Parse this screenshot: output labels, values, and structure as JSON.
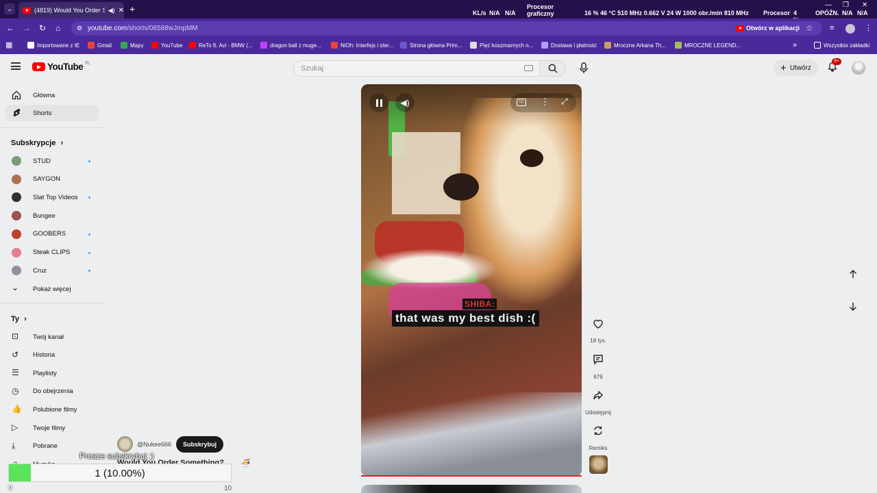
{
  "browser": {
    "tab_title": "(4819) Would You Order So",
    "new_tab": "+",
    "url_host": "youtube.com",
    "url_path": "/shorts/06588wJmpMM",
    "open_in_app": "Otwórz w aplikacji",
    "hwinfo": {
      "kbs": "KL/s",
      "na1": "N/A",
      "na2": "N/A",
      "gpu_label_1": "Procesor",
      "gpu_label_2": "graficzny",
      "gpu_stats": "16 % 46 °C 510 MHz 0.662 V 24 W 1000 obr./min 810 MHz",
      "cpu_label": "Procesor",
      "cpu_value": "4 %",
      "lat_label": "OPÓŹN.",
      "na3": "N/A",
      "na4": "N/A"
    },
    "bookmarks": [
      {
        "label": "Importowane z IE",
        "color": "#ffffff"
      },
      {
        "label": "Gmail",
        "color": "#ea4335"
      },
      {
        "label": "Mapy",
        "color": "#34a853"
      },
      {
        "label": "YouTube",
        "color": "#ff0000"
      },
      {
        "label": "ReTo ft. Avi - BMW (...",
        "color": "#ff0000"
      },
      {
        "label": "dragon ball z muge...",
        "color": "#c040ff"
      },
      {
        "label": "NiOh: Interfejs i ster...",
        "color": "#ea4335"
      },
      {
        "label": "Strona główna Prim...",
        "color": "#6a5acd"
      },
      {
        "label": "Pięć koszmarnych n...",
        "color": "#dddddd"
      },
      {
        "label": "Dostawa i płatność",
        "color": "#b59cff"
      },
      {
        "label": "Mroczne Arkana Th...",
        "color": "#c8a060"
      },
      {
        "label": "MROCZNE LEGEND...",
        "color": "#a0c060"
      }
    ],
    "all_bookmarks": "Wszystkie zakładki"
  },
  "masthead": {
    "logo_text": "YouTube",
    "logo_region": "PL",
    "search_placeholder": "Szukaj",
    "create_label": "Utwórz",
    "notif_badge": "9+"
  },
  "sidebar": {
    "main": [
      {
        "label": "Główna",
        "icon": "home-icon"
      },
      {
        "label": "Shorts",
        "icon": "shorts-icon"
      }
    ],
    "subs_header": "Subskrypcje",
    "subs": [
      {
        "label": "STUD",
        "color": "#7a9a7a",
        "dot": true
      },
      {
        "label": "SAYGON",
        "color": "#b07050",
        "dot": false
      },
      {
        "label": "Slat Top Videos",
        "color": "#303030",
        "dot": true
      },
      {
        "label": "Bungee",
        "color": "#a05050",
        "dot": false
      },
      {
        "label": "GOOBERS",
        "color": "#c04030",
        "dot": true
      },
      {
        "label": "Steak CLIPS",
        "color": "#e08090",
        "dot": true
      },
      {
        "label": "Cruz",
        "color": "#9090a0",
        "dot": true
      }
    ],
    "show_more": "Pokaż więcej",
    "you_header": "Ty",
    "you": [
      {
        "label": "Twój kanał",
        "icon": "channel-icon"
      },
      {
        "label": "Historia",
        "icon": "history-icon"
      },
      {
        "label": "Playlisty",
        "icon": "playlist-icon"
      },
      {
        "label": "Do obejrzenia",
        "icon": "watch-later-icon"
      },
      {
        "label": "Polubione filmy",
        "icon": "like-icon"
      },
      {
        "label": "Twoje filmy",
        "icon": "video-icon"
      },
      {
        "label": "Pobrane",
        "icon": "download-icon"
      },
      {
        "label": "Muzyka",
        "icon": "music-icon"
      }
    ]
  },
  "short": {
    "caption_speaker": "SHIBA:",
    "caption_text": "that was my best dish :(",
    "channel": "@Nukee666",
    "subscribe": "Subskrybuj",
    "title": "Would You Order Something?",
    "likes": "18 tys.",
    "comments": "676",
    "share": "Udostępnij",
    "remix": "Remiks"
  },
  "overlay": {
    "message": "Prosze subskrybuj :)",
    "goal_text": "1 (10.00%)",
    "goal_fraction": 0.1,
    "min": "0",
    "max": "10"
  }
}
